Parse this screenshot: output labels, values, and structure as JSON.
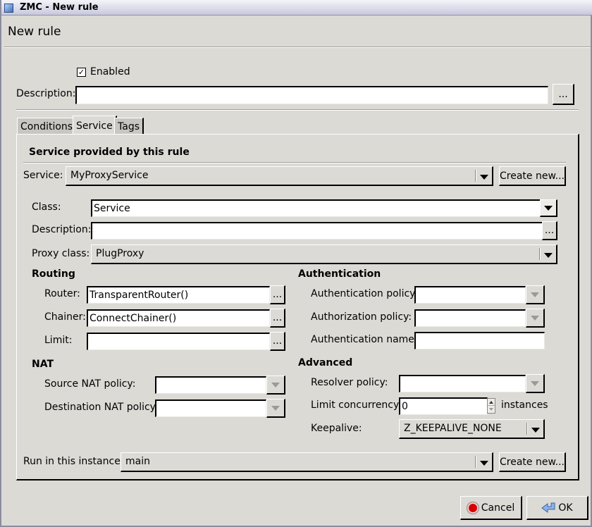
{
  "window": {
    "title": "ZMC - New rule",
    "heading": "New rule"
  },
  "rule": {
    "enabled_label": "Enabled",
    "enabled_checked": true,
    "description_label": "Description:",
    "description_value": "",
    "description_browse": "..."
  },
  "tabs": [
    {
      "label": "Conditions",
      "active": false
    },
    {
      "label": "Service",
      "active": true
    },
    {
      "label": "Tags",
      "active": false
    }
  ],
  "service_section": {
    "title": "Service provided by this rule",
    "service_label": "Service:",
    "service_value": "MyProxyService",
    "create_new": "Create new...",
    "class_label": "Class:",
    "class_value": "Service",
    "description_label": "Description:",
    "description_value": "",
    "description_browse": "...",
    "proxy_class_label": "Proxy class:",
    "proxy_class_value": "PlugProxy"
  },
  "routing": {
    "title": "Routing",
    "router_label": "Router:",
    "router_value": "TransparentRouter()",
    "chainer_label": "Chainer:",
    "chainer_value": "ConnectChainer()",
    "limit_label": "Limit:",
    "limit_value": "",
    "browse": "..."
  },
  "nat": {
    "title": "NAT",
    "source_label": "Source NAT policy:",
    "source_value": "",
    "destination_label": "Destination NAT policy:",
    "destination_value": ""
  },
  "authentication": {
    "title": "Authentication",
    "auth_policy_label": "Authentication policy:",
    "auth_policy_value": "",
    "authz_policy_label": "Authorization policy:",
    "authz_policy_value": "",
    "auth_name_label": "Authentication name:",
    "auth_name_value": ""
  },
  "advanced": {
    "title": "Advanced",
    "resolver_label": "Resolver policy:",
    "resolver_value": "",
    "limit_concurrency_label": "Limit concurrency:",
    "limit_concurrency_value": "0",
    "instances_label": "instances",
    "keepalive_label": "Keepalive:",
    "keepalive_value": "Z_KEEPALIVE_NONE"
  },
  "instance": {
    "label": "Run in this instance:",
    "value": "main",
    "create_new": "Create new..."
  },
  "buttons": {
    "cancel": "Cancel",
    "ok": "OK"
  }
}
